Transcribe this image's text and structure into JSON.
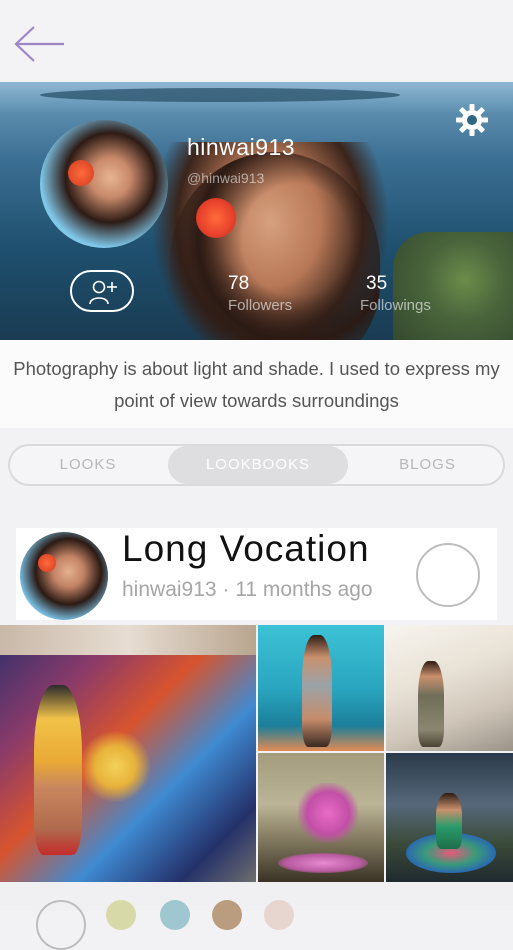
{
  "profile": {
    "username": "hinwai913",
    "handle": "@hinwai913",
    "bio": "Photography is about light and shade. I used to express my point of view towards surroundings",
    "followers": {
      "count": "78",
      "label": "Followers"
    },
    "followings": {
      "count": "35",
      "label": "Followings"
    }
  },
  "tabs": [
    {
      "label": "LOOKS",
      "active": false
    },
    {
      "label": "LOOKBOOKS",
      "active": true
    },
    {
      "label": "BLOGS",
      "active": false
    }
  ],
  "lookbook": {
    "title": "Long Vocation",
    "meta": "hinwai913 · 11 months ago"
  },
  "icons": {
    "back": "arrow-left-icon",
    "settings": "gear-icon",
    "follow": "add-user-icon"
  },
  "colors": {
    "accent": "#9d86c6",
    "tab_active_bg": "#dedddf",
    "hero": "#1e4f6e"
  }
}
